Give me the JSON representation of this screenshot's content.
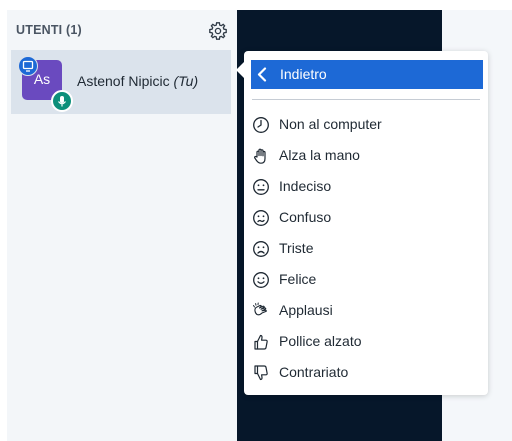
{
  "users_panel": {
    "title": "UTENTI (1)",
    "settings_icon": "gear-icon",
    "user": {
      "initials": "As",
      "name": "Astenof Nipicic",
      "you_label": "(Tu)",
      "avatar_color": "#6a4abf",
      "top_badge_icon": "presenter-icon",
      "bottom_badge_icon": "microphone-icon"
    }
  },
  "status_menu": {
    "back_label": "Indietro",
    "items": [
      {
        "label": "Non al computer",
        "icon": "clock-icon"
      },
      {
        "label": "Alza la mano",
        "icon": "raised-hand-icon"
      },
      {
        "label": "Indeciso",
        "icon": "neutral-face-icon"
      },
      {
        "label": "Confuso",
        "icon": "confused-face-icon"
      },
      {
        "label": "Triste",
        "icon": "sad-face-icon"
      },
      {
        "label": "Felice",
        "icon": "happy-face-icon"
      },
      {
        "label": "Applausi",
        "icon": "applause-icon"
      },
      {
        "label": "Pollice alzato",
        "icon": "thumbs-up-icon"
      },
      {
        "label": "Contrariato",
        "icon": "thumbs-down-icon"
      }
    ]
  },
  "colors": {
    "accent": "#1d69d6",
    "dark_area": "#06172a",
    "panel_bg": "#f3f6f9",
    "selected_row": "#dbe3ec"
  }
}
